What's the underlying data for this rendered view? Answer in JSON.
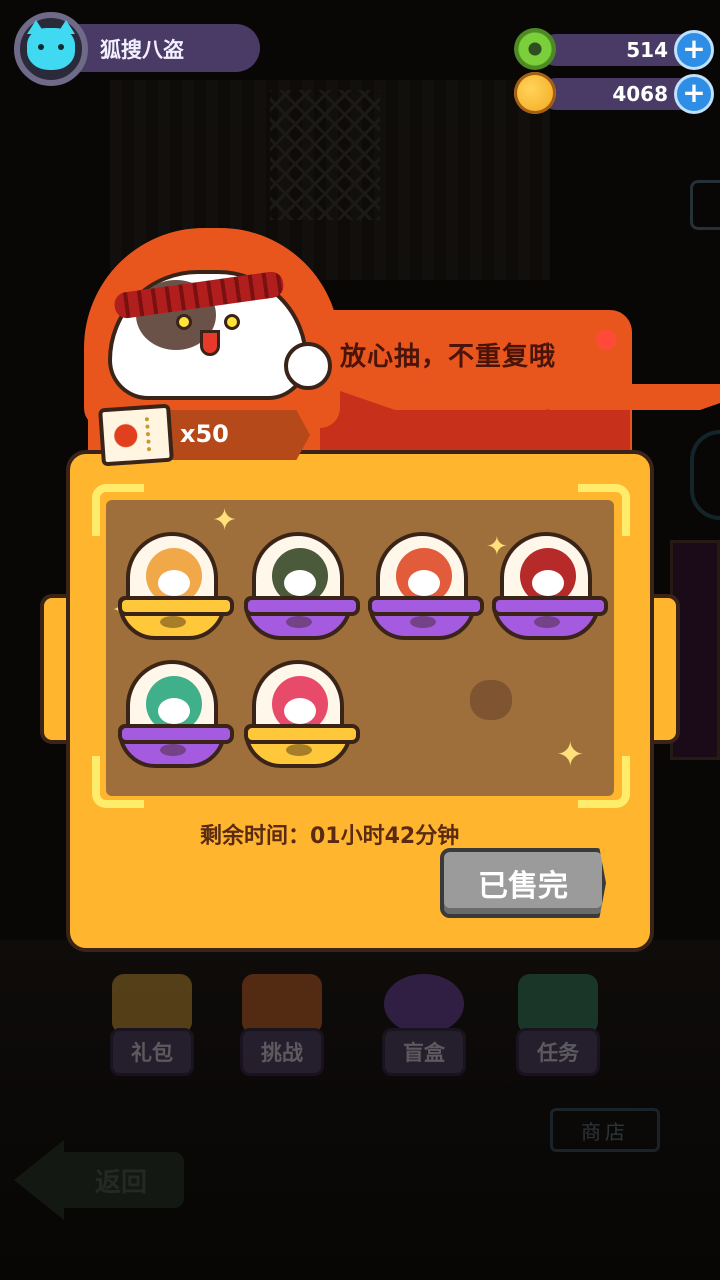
{
  "player": {
    "name": "狐搜八盗"
  },
  "currencies": [
    {
      "icon": "donut-coin-icon",
      "value": "514"
    },
    {
      "icon": "planet-coin-icon",
      "value": "4068"
    }
  ],
  "modal": {
    "slogan": "放心抽，不重复哦",
    "ticket_count": "x50",
    "capsules": [
      {
        "base": "gold",
        "figure_color": "#f0a848"
      },
      {
        "base": "purple",
        "figure_color": "#4a5a3a"
      },
      {
        "base": "purple",
        "figure_color": "#e25b3a"
      },
      {
        "base": "purple",
        "figure_color": "#b72a2a"
      },
      {
        "base": "purple",
        "figure_color": "#3fb08a"
      },
      {
        "base": "gold",
        "figure_color": "#e84a6a"
      }
    ],
    "remaining_time": "剩余时间：01小时42分钟",
    "sold_out_label": "已售完"
  },
  "bottom_nav": [
    {
      "label": "礼包",
      "icon": "gift-box-icon"
    },
    {
      "label": "挑战",
      "icon": "tv-icon"
    },
    {
      "label": "盲盒",
      "icon": "capsule-icon"
    },
    {
      "label": "任务",
      "icon": "clipboard-icon"
    }
  ],
  "shop_sign": "商店",
  "back_label": "返回",
  "colors": {
    "modal_yellow": "#ffb62e",
    "header_orange": "#e8561e",
    "stage_brown": "#9f6f3b",
    "nav_purple": "#5a4872"
  }
}
